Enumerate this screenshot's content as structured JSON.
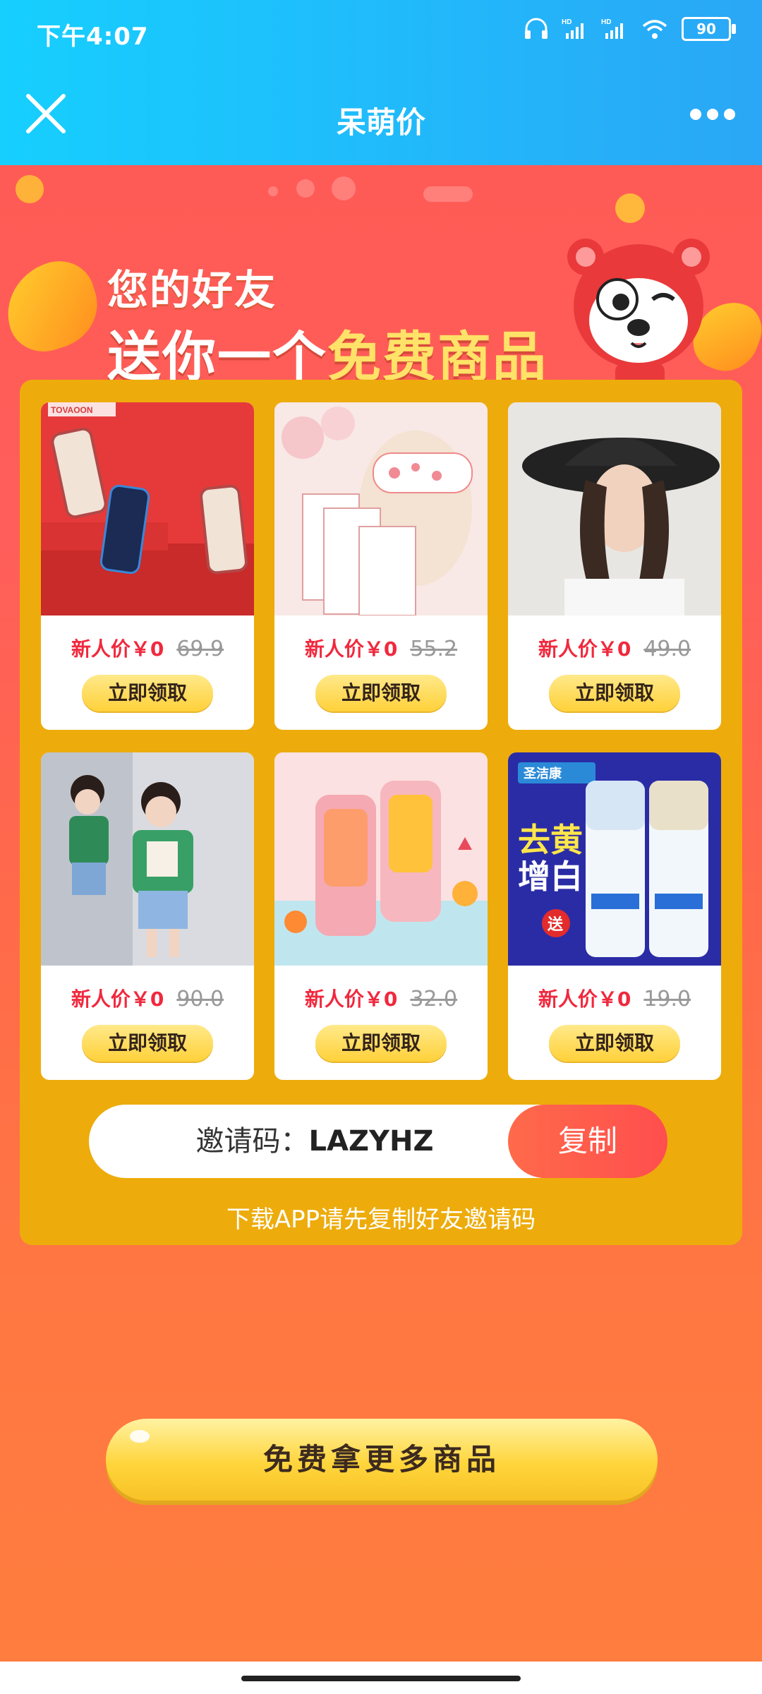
{
  "status": {
    "time": "下午4:07",
    "battery": "90",
    "icons": [
      "headset-icon",
      "signal-hd-1-icon",
      "signal-hd-2-icon",
      "wifi-icon",
      "battery-icon"
    ]
  },
  "header": {
    "title": "呆萌价",
    "close_icon": "close-icon",
    "more_icon": "more-icon"
  },
  "hero": {
    "line1": "您的好友",
    "line2_prefix": "送你一个",
    "line2_highlight": "免费商品"
  },
  "products": [
    {
      "new_price": "新人价￥0",
      "old_price": "69.9",
      "button": "立即领取",
      "brand": "TOVAOON"
    },
    {
      "new_price": "新人价￥0",
      "old_price": "55.2",
      "button": "立即领取"
    },
    {
      "new_price": "新人价￥0",
      "old_price": "49.0",
      "button": "立即领取"
    },
    {
      "new_price": "新人价￥0",
      "old_price": "90.0",
      "button": "立即领取"
    },
    {
      "new_price": "新人价￥0",
      "old_price": "32.0",
      "button": "立即领取"
    },
    {
      "new_price": "新人价￥0",
      "old_price": "19.0",
      "button": "立即领取",
      "label_1": "圣洁康",
      "label_2": "去黄",
      "label_3": "增白",
      "label_4": "送"
    }
  ],
  "invite": {
    "label": "邀请码：",
    "code": "LAZYHZ",
    "copy": "复制",
    "hint": "下载APP请先复制好友邀请码"
  },
  "cta": {
    "label": "免费拿更多商品"
  },
  "colors": {
    "header_start": "#16cfff",
    "header_end": "#2aa7f6",
    "panel": "#edac0c",
    "price_red": "#f0293e",
    "button_yellow": "#ffd13a"
  }
}
